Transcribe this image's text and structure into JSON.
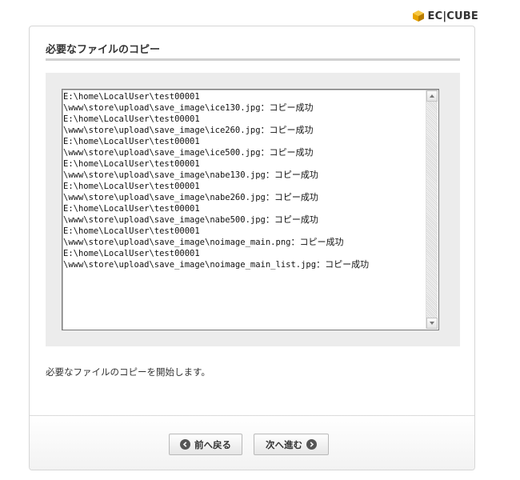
{
  "header": {
    "logo_text": "EC|CUBE"
  },
  "panel": {
    "heading": "必要なファイルのコピー",
    "log_lines": [
      {
        "path": "E:\\home\\LocalUser\\test00001",
        "status": ""
      },
      {
        "path": "\\www\\store\\upload\\save_image\\ice130.jpg",
        "status": "：コピー成功"
      },
      {
        "path": "E:\\home\\LocalUser\\test00001",
        "status": ""
      },
      {
        "path": "\\www\\store\\upload\\save_image\\ice260.jpg",
        "status": "：コピー成功"
      },
      {
        "path": "E:\\home\\LocalUser\\test00001",
        "status": ""
      },
      {
        "path": "\\www\\store\\upload\\save_image\\ice500.jpg",
        "status": "：コピー成功"
      },
      {
        "path": "E:\\home\\LocalUser\\test00001",
        "status": ""
      },
      {
        "path": "\\www\\store\\upload\\save_image\\nabe130.jpg",
        "status": "：コピー成功"
      },
      {
        "path": "E:\\home\\LocalUser\\test00001",
        "status": ""
      },
      {
        "path": "\\www\\store\\upload\\save_image\\nabe260.jpg",
        "status": "：コピー成功"
      },
      {
        "path": "E:\\home\\LocalUser\\test00001",
        "status": ""
      },
      {
        "path": "\\www\\store\\upload\\save_image\\nabe500.jpg",
        "status": "：コピー成功"
      },
      {
        "path": "E:\\home\\LocalUser\\test00001",
        "status": ""
      },
      {
        "path": "\\www\\store\\upload\\save_image\\noimage_main.png",
        "status": "：コピー成功"
      },
      {
        "path": "E:\\home\\LocalUser\\test00001",
        "status": ""
      },
      {
        "path": "\\www\\store\\upload\\save_image\\noimage_main_list.jpg",
        "status": "：コピー成功"
      }
    ],
    "message": "必要なファイルのコピーを開始します。"
  },
  "footer": {
    "back_label": "前へ戻る",
    "next_label": "次へ進む"
  },
  "colors": {
    "logo_cube": "#e8a400",
    "button_icon": "#555555",
    "log_background": "#ececec"
  },
  "icons": {
    "logo": "cube-icon",
    "back": "circle-left-arrow-icon",
    "next": "circle-right-arrow-icon",
    "scroll_up": "triangle-up-icon",
    "scroll_down": "triangle-down-icon"
  }
}
